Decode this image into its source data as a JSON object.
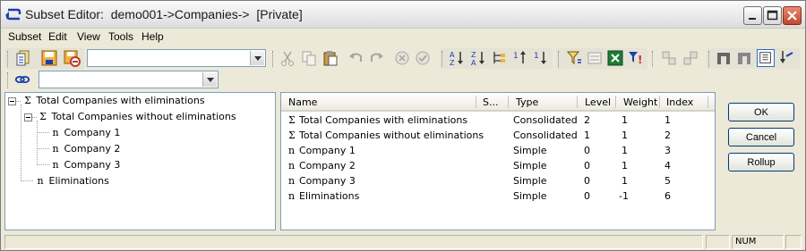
{
  "window": {
    "title": "Subset Editor:  demo001->Companies->  [Private]"
  },
  "menu": {
    "items": [
      {
        "label": "Subset"
      },
      {
        "label": "Edit"
      },
      {
        "label": "View"
      },
      {
        "label": "Tools"
      },
      {
        "label": "Help"
      }
    ]
  },
  "toolbar": {
    "subset_combo_value": "",
    "filter_combo_value": ""
  },
  "tree": {
    "nodes": [
      {
        "glyph": "Σ",
        "label": "Total Companies with eliminations",
        "expanded": true
      },
      {
        "glyph": "Σ",
        "label": "Total Companies without eliminations",
        "expanded": true
      },
      {
        "glyph": "n",
        "label": "Company 1"
      },
      {
        "glyph": "n",
        "label": "Company 2"
      },
      {
        "glyph": "n",
        "label": "Company 3"
      },
      {
        "glyph": "n",
        "label": "Eliminations"
      }
    ]
  },
  "list": {
    "columns": [
      "Name",
      "S...",
      "Type",
      "Level",
      "Weight",
      "Index"
    ],
    "rows": [
      {
        "glyph": "Σ",
        "name": "Total Companies with eliminations",
        "type": "Consolidated",
        "level": "2",
        "weight": "1",
        "index": "1"
      },
      {
        "glyph": "Σ",
        "name": "Total Companies without eliminations",
        "type": "Consolidated",
        "level": "1",
        "weight": "1",
        "index": "2"
      },
      {
        "glyph": "n",
        "name": "Company 1",
        "type": "Simple",
        "level": "0",
        "weight": "1",
        "index": "3"
      },
      {
        "glyph": "n",
        "name": "Company 2",
        "type": "Simple",
        "level": "0",
        "weight": "1",
        "index": "4"
      },
      {
        "glyph": "n",
        "name": "Company 3",
        "type": "Simple",
        "level": "0",
        "weight": "1",
        "index": "5"
      },
      {
        "glyph": "n",
        "name": "Eliminations",
        "type": "Simple",
        "level": "0",
        "weight": "-1",
        "index": "6"
      }
    ]
  },
  "buttons": {
    "ok": "OK",
    "cancel": "Cancel",
    "rollup": "Rollup"
  },
  "status": {
    "num": "NUM"
  }
}
